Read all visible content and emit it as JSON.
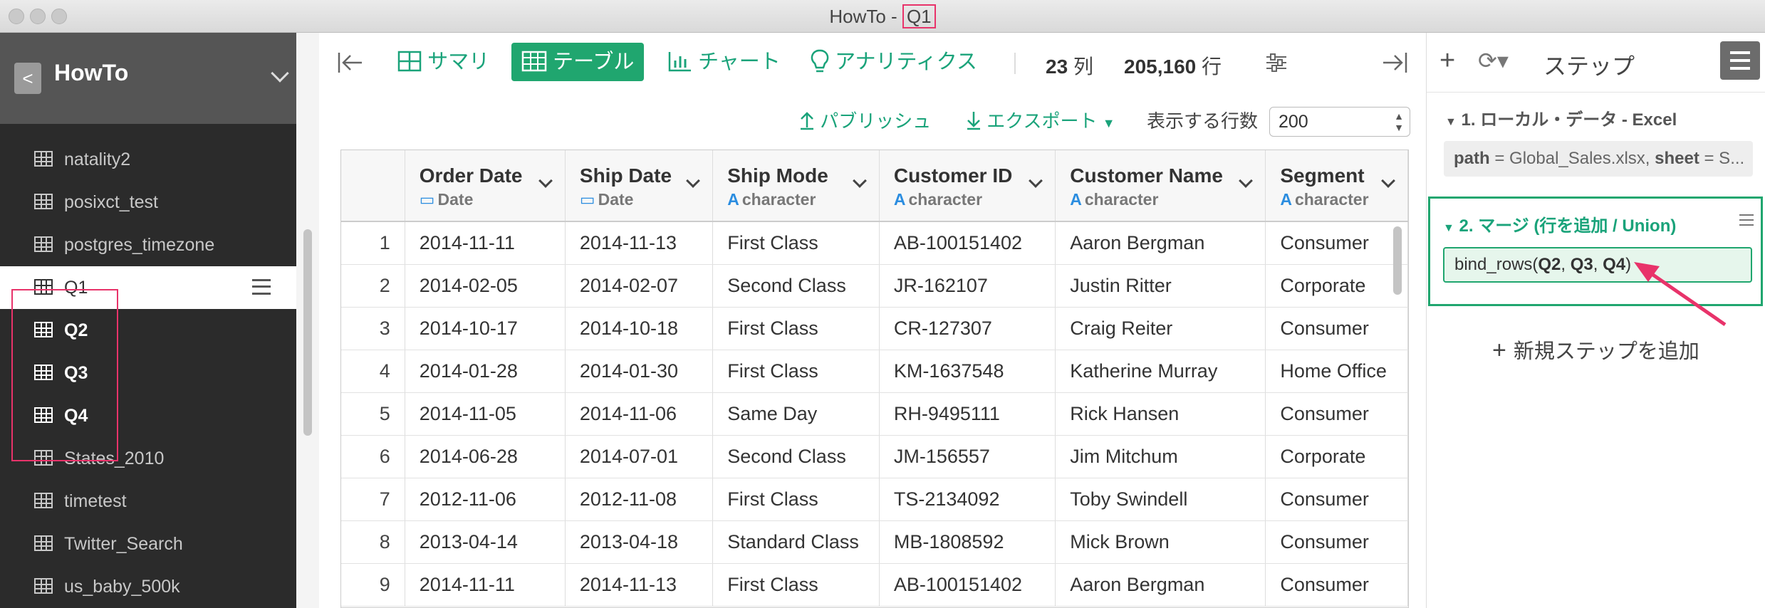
{
  "window": {
    "title_prefix": "HowTo - ",
    "title_highlight": "Q1"
  },
  "sidebar": {
    "back_label": "<",
    "project": "HowTo",
    "items": [
      {
        "label": "natality2"
      },
      {
        "label": "posixct_test"
      },
      {
        "label": "postgres_timezone"
      },
      {
        "label": "Q1"
      },
      {
        "label": "Q2"
      },
      {
        "label": "Q3"
      },
      {
        "label": "Q4"
      },
      {
        "label": "States_2010"
      },
      {
        "label": "timetest"
      },
      {
        "label": "Twitter_Search"
      },
      {
        "label": "us_baby_500k"
      }
    ]
  },
  "toolbar": {
    "summary": "サマリ",
    "table": "テーブル",
    "chart": "チャート",
    "analytics": "アナリティクス",
    "cols_count": "23",
    "cols_unit": "列",
    "rows_count": "205,160",
    "rows_unit": "行"
  },
  "subbar": {
    "publish": "パブリッシュ",
    "export": "エクスポート",
    "rows_label": "表示する行数",
    "rows_value": "200"
  },
  "table": {
    "columns": [
      {
        "name": "Order Date",
        "type": "Date",
        "type_icon": "calendar-icon"
      },
      {
        "name": "Ship Date",
        "type": "Date",
        "type_icon": "calendar-icon"
      },
      {
        "name": "Ship Mode",
        "type": "character",
        "type_icon": "A"
      },
      {
        "name": "Customer ID",
        "type": "character",
        "type_icon": "A"
      },
      {
        "name": "Customer Name",
        "type": "character",
        "type_icon": "A"
      },
      {
        "name": "Segment",
        "type": "character",
        "type_icon": "A"
      }
    ],
    "rows": [
      [
        "1",
        "2014-11-11",
        "2014-11-13",
        "First Class",
        "AB-100151402",
        "Aaron Bergman",
        "Consumer"
      ],
      [
        "2",
        "2014-02-05",
        "2014-02-07",
        "Second Class",
        "JR-162107",
        "Justin Ritter",
        "Corporate"
      ],
      [
        "3",
        "2014-10-17",
        "2014-10-18",
        "First Class",
        "CR-127307",
        "Craig Reiter",
        "Consumer"
      ],
      [
        "4",
        "2014-01-28",
        "2014-01-30",
        "First Class",
        "KM-1637548",
        "Katherine Murray",
        "Home Office"
      ],
      [
        "5",
        "2014-11-05",
        "2014-11-06",
        "Same Day",
        "RH-9495111",
        "Rick Hansen",
        "Consumer"
      ],
      [
        "6",
        "2014-06-28",
        "2014-07-01",
        "Second Class",
        "JM-156557",
        "Jim Mitchum",
        "Corporate"
      ],
      [
        "7",
        "2012-11-06",
        "2012-11-08",
        "First Class",
        "TS-2134092",
        "Toby Swindell",
        "Consumer"
      ],
      [
        "8",
        "2013-04-14",
        "2013-04-18",
        "Standard Class",
        "MB-1808592",
        "Mick Brown",
        "Consumer"
      ],
      [
        "9",
        "2014-11-11",
        "2014-11-13",
        "First Class",
        "AB-100151402",
        "Aaron Bergman",
        "Consumer"
      ]
    ]
  },
  "steps": {
    "title": "ステップ",
    "step1_title": "1. ローカル・データ - Excel",
    "step1_key1": "path",
    "step1_val1": " = Global_Sales.xlsx, ",
    "step1_key2": "sheet",
    "step1_val2": " = S...",
    "step2_title": "2. マージ (行を追加 / Union)",
    "step2_fn": "bind_rows(",
    "step2_args": [
      "Q2",
      "Q3",
      "Q4"
    ],
    "step2_sep": ", ",
    "step2_close": ")",
    "add_step": "新規ステップを追加"
  },
  "colors": {
    "accent": "#20a66f",
    "highlight": "#e8336a",
    "sidebar_bg": "#2b2b2b"
  }
}
